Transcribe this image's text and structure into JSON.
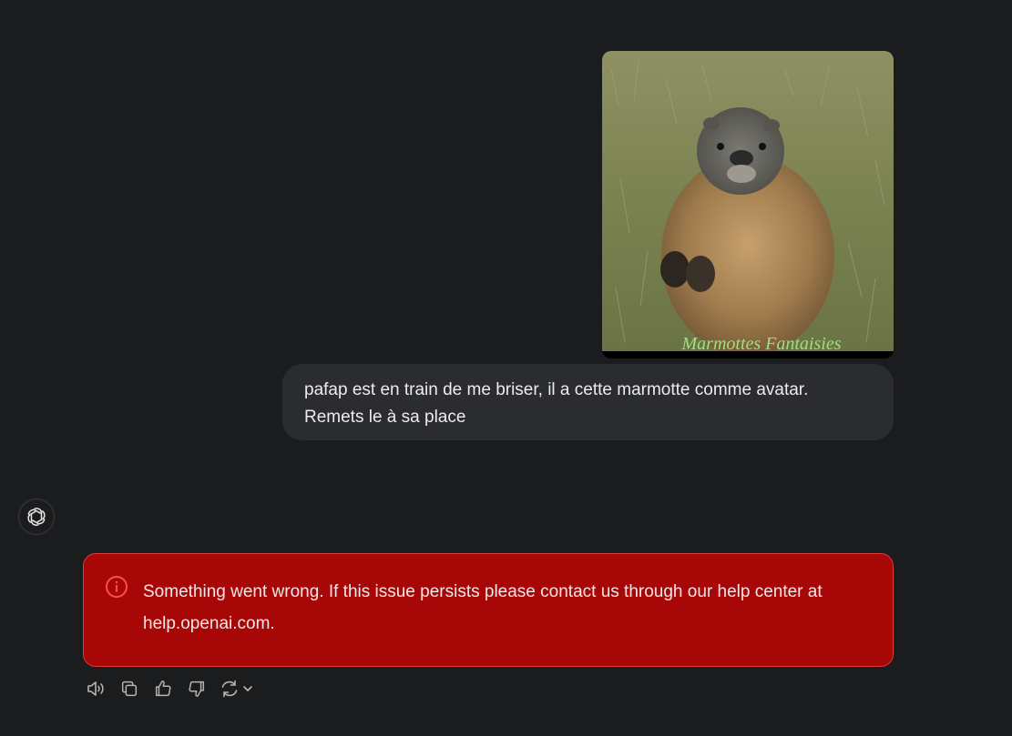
{
  "user_message": {
    "image_caption": "Marmottes Fantaisies",
    "text": "pafap est en train de me briser, il a cette marmotte comme avatar. Remets le à sa place"
  },
  "assistant": {
    "avatar_icon": "openai-logo-icon"
  },
  "error": {
    "icon": "info-circle-icon",
    "message": "Something went wrong. If this issue persists please contact us through our help center at help.openai.com.",
    "color": "#a80707",
    "border_color": "#e23a3a"
  },
  "actions": [
    {
      "icon": "speaker-icon"
    },
    {
      "icon": "copy-icon"
    },
    {
      "icon": "thumbs-up-icon"
    },
    {
      "icon": "thumbs-down-icon"
    },
    {
      "icon": "regenerate-icon"
    }
  ]
}
